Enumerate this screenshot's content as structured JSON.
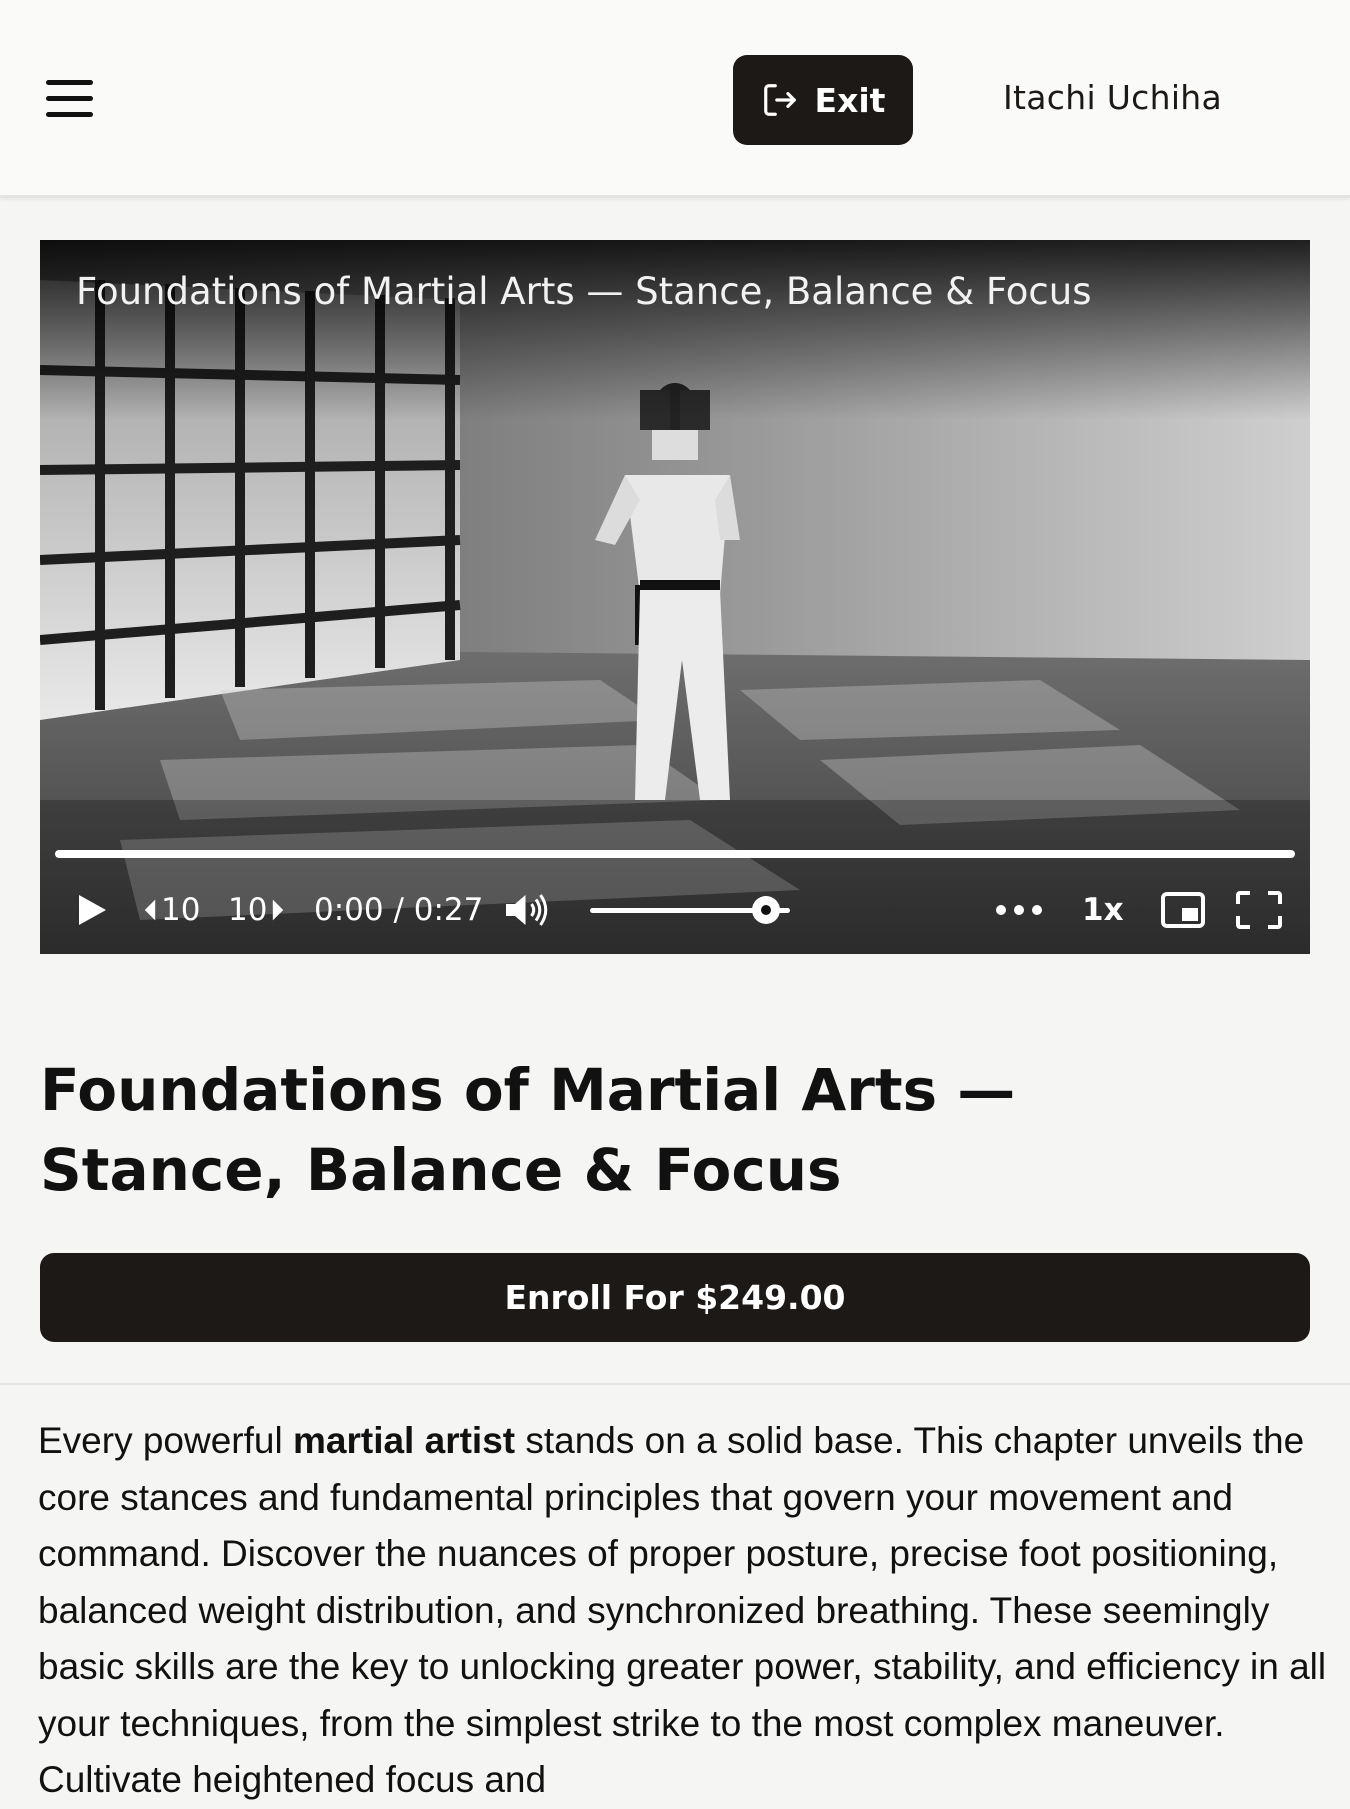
{
  "header": {
    "menu_icon": "hamburger-menu-icon",
    "exit_label": "Exit",
    "exit_icon": "sign-out-icon",
    "user_name": "Itachi Uchiha"
  },
  "video": {
    "overlay_title": "Foundations of Martial Arts — Stance, Balance & Focus",
    "rewind_label": "10",
    "forward_label": "10",
    "time_display": "0:00 / 0:27",
    "volume_level": 0.88,
    "more_icon": "more-dots-icon",
    "speed_label": "1x",
    "pip_icon": "picture-in-picture-icon",
    "fullscreen_icon": "fullscreen-icon"
  },
  "course": {
    "title": "Foundations of Martial Arts — Stance, Balance & Focus",
    "enroll_label": "Enroll For $249.00"
  },
  "description": {
    "before_bold": "Every powerful ",
    "bold": "martial artist",
    "after_bold": " stands on a solid base. This chapter unveils the core stances and fundamental principles that govern your movement and command. Discover the nuances of proper posture, precise foot positioning, balanced weight distribution, and synchronized breathing. These seemingly basic skills are the key to unlocking greater power, stability, and efficiency in all your techniques, from the simplest strike to the most complex maneuver. Cultivate heightened focus and"
  },
  "colors": {
    "dark": "#1c1917",
    "background": "#f5f5f4",
    "header_bg": "#fafaf9"
  }
}
